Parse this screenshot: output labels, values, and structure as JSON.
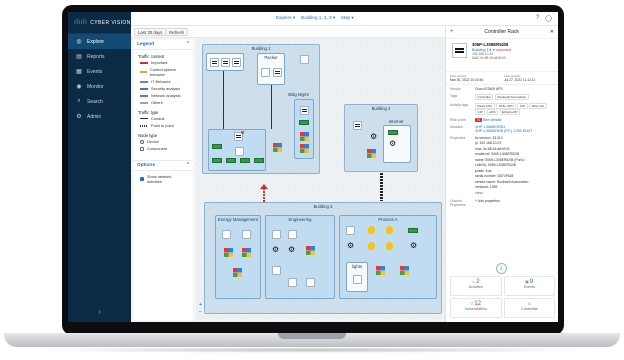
{
  "app": {
    "brand": "CYBER VISION"
  },
  "sidebar": {
    "items": [
      {
        "label": "Explore",
        "icon": "compass-icon"
      },
      {
        "label": "Reports",
        "icon": "document-icon"
      },
      {
        "label": "Events",
        "icon": "calendar-icon"
      },
      {
        "label": "Monitor",
        "icon": "eye-icon"
      },
      {
        "label": "Search",
        "icon": "search-icon"
      },
      {
        "label": "Admin",
        "icon": "gear-icon"
      }
    ],
    "collapse_icon": "‹"
  },
  "breadcrumb": {
    "items": [
      "Explore ▾",
      "Building 1, 2, 3 ▾",
      "Map ▾"
    ]
  },
  "toolbar": {
    "period": "Last 30 days",
    "refresh": "Refresh"
  },
  "legend": {
    "title": "Legend",
    "traffic_content_label": "Traffic content",
    "traffic_content": [
      {
        "label": "Important",
        "color": "#d32f2f"
      },
      {
        "label": "Control system behavior",
        "color": "#f2a03d"
      },
      {
        "label": "IT Behavior",
        "color": "#8e6bd1"
      },
      {
        "label": "Security analysis",
        "color": "#3a7bd5"
      },
      {
        "label": "Network analysis",
        "color": "#43a047"
      },
      {
        "label": "Others",
        "color": "#9aa3ac"
      }
    ],
    "traffic_type_label": "Traffic type",
    "traffic_type": [
      "Conduit",
      "Point to point"
    ],
    "node_type_label": "Node type",
    "node_type": [
      "Device",
      "Component"
    ],
    "options_title": "Options",
    "options_checkbox": "Show network activities"
  },
  "map": {
    "building1": "Building 1",
    "building2": "Building 2",
    "building3": "Building 3",
    "packer": "Packer",
    "bldg_mgmt": "Bldg Mgmt",
    "internet": "Internet",
    "energy": "Energy Management",
    "engineering": "Engineering",
    "process": "Process A",
    "lights": "lights",
    "zoom_in": "+",
    "zoom_out": "−"
  },
  "details": {
    "title": "Controller Rack",
    "device_name": "306P-L306ER52/B",
    "device_link": "Building 1 ▸",
    "device_flag": "● untrusted",
    "ip": "192.168.10.23",
    "mac": "MAC 5c:88:16:a8:6f:03",
    "first_activity_label": "First activity",
    "first_activity": "Mar 30, 2022 10:23:45",
    "last_activity_label": "Last activity",
    "last_activity": "Jul 27, 2022 11:12:11",
    "vendor_label": "Vendor",
    "vendor": "Cisco IE3400 AP3",
    "tags_label": "Tags",
    "tags": [
      "Controller",
      "Rockwell Automation"
    ],
    "activity_tags_label": "Activity tags",
    "activity_tags": [
      "Read CPU",
      "Write CPU",
      "CIP",
      "Write Var",
      "CIP",
      "ADS",
      "Ethernet/IP"
    ],
    "risk_label": "Risk score",
    "risk_score": "70",
    "risk_link": "See details",
    "modules_label": "Modules",
    "modules": [
      "1HP-L3066ER/B1",
      "1HP-L3065ER/B (PC) 1756-EN2T"
    ],
    "properties_label": "Properties",
    "properties": [
      "fw-version: 33.012",
      "ip: 192.168.10.23",
      "mac: 5c:88:16:a8:6f:03",
      "model-ref: 5069-L306ER52/B",
      "name: 5069-L306ER52/B (Port1=",
      "Link00), 5069-L306ER52/B",
      "public: true",
      "serial-number: D874F628",
      "vendor-name: Rockwell Automation",
      "vendorid: 1069",
      "view"
    ],
    "custom_label": "Custom Properties",
    "custom_link": "+ Add properties",
    "stats": [
      {
        "value": "2",
        "label": "Activities",
        "icon": "activity-icon"
      },
      {
        "value": "9",
        "label": "Events",
        "icon": "calendar-icon"
      },
      {
        "value": "12",
        "label": "Vulnerabilities",
        "icon": "shield-icon"
      },
      {
        "value": "",
        "label": "Credential",
        "icon": "key-icon"
      }
    ]
  }
}
